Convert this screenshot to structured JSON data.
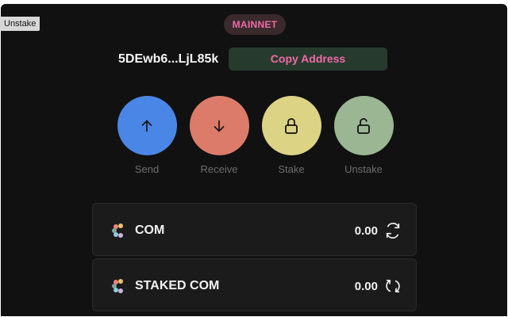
{
  "tooltip": {
    "text": "Unstake"
  },
  "network": {
    "label": "MAINNET",
    "color": "#ef6aa6"
  },
  "wallet": {
    "address_short": "5DEwb6...LjL85k",
    "copy_label": "Copy Address"
  },
  "actions": [
    {
      "label": "Send",
      "icon": "arrow-up-icon",
      "color": "#4a86e6"
    },
    {
      "label": "Receive",
      "icon": "arrow-down-icon",
      "color": "#dc7b6a"
    },
    {
      "label": "Stake",
      "icon": "lock-icon",
      "color": "#dcd385"
    },
    {
      "label": "Unstake",
      "icon": "unlock-icon",
      "color": "#9bb693"
    }
  ],
  "balances": [
    {
      "name": "COM",
      "amount": "0.00",
      "icon": "token-logo-icon",
      "action_icon": "refresh-icon"
    },
    {
      "name": "STAKED COM",
      "amount": "0.00",
      "icon": "token-logo-icon",
      "action_icon": "sync-icon"
    }
  ]
}
